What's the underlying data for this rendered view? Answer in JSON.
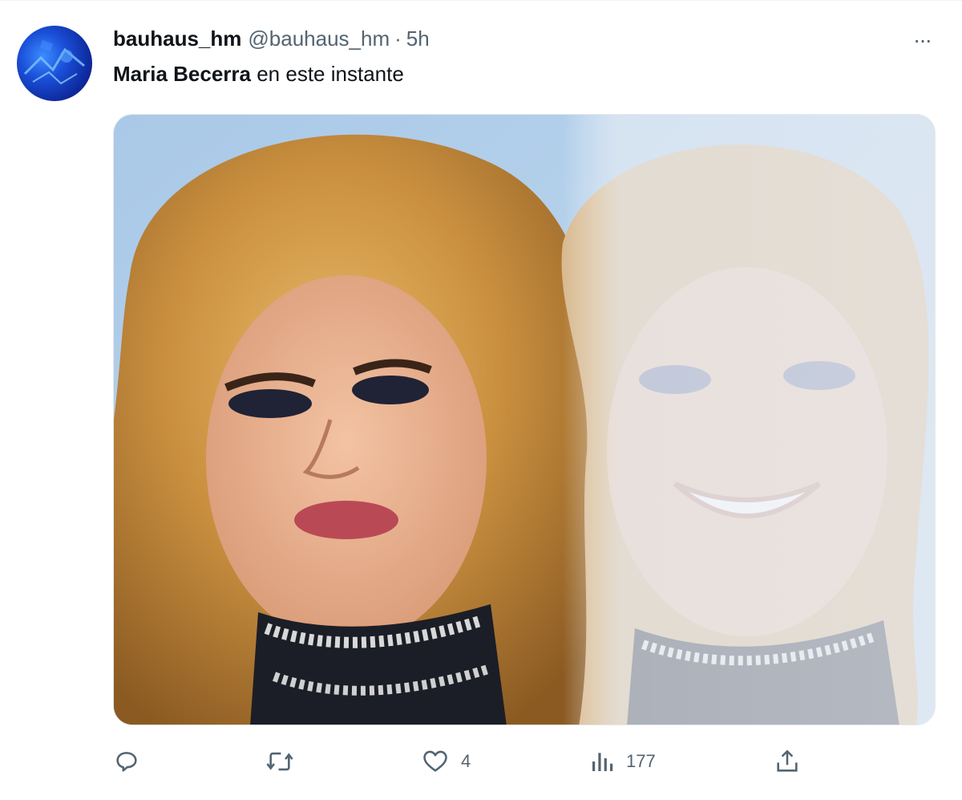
{
  "tweet": {
    "display_name": "bauhaus_hm",
    "handle": "@bauhaus_hm",
    "separator": "·",
    "time": "5h",
    "text_bold": "Maria Becerra",
    "text_rest": " en este instante",
    "more_label": "···"
  },
  "actions": {
    "reply_icon": "reply-icon",
    "retweet_icon": "retweet-icon",
    "like_icon": "heart-icon",
    "like_count": "4",
    "views_icon": "views-icon",
    "views_count": "177",
    "share_icon": "share-icon"
  },
  "colors": {
    "text_primary": "#0f1419",
    "text_secondary": "#536471",
    "background": "#ffffff"
  }
}
